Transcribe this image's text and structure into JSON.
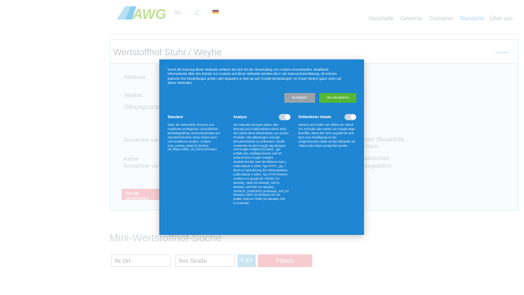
{
  "header": {
    "logo_text": "AWG",
    "icons": [
      "mail-icon",
      "phone-icon",
      "german-flag-icon"
    ],
    "nav": [
      {
        "label": "Haushalte",
        "active": false
      },
      {
        "label": "Gewerbe",
        "active": false
      },
      {
        "label": "Container",
        "active": false
      },
      {
        "label": "Standorte",
        "active": true
      },
      {
        "label": "Über uns",
        "active": false
      }
    ]
  },
  "card": {
    "title": "Wertstoffhof Stuhr / Weyhe",
    "labels": {
      "address": "Adresse",
      "phone": "Telefon",
      "hours": "Öffnungszeiten",
      "accepted_from": "Annahme von",
      "no": "Keine",
      "accepted_from2": "Annahme von"
    },
    "right_snippets": {
      "a": "eter (Bauabfälle,",
      "b": "chten",
      "c": "ahrischen",
      "d": "angeliefert."
    },
    "route_button": "Route berechnen"
  },
  "search": {
    "title": "Mini-Wertstoffhof-Suche",
    "place_placeholder": "Ihr Ort",
    "street_placeholder": "Ihre Straße",
    "radius": "5 km",
    "filter_label": "Filtern"
  },
  "cookie": {
    "intro": "Durch die Nutzung dieser Webseite erklären Sie sich mit der Verwendung von Cookies einverstanden. Detaillierte Informationen über den Einsatz von Cookies auf dieser Webseite erhalten Sie in der Datenschutzerklärung. Sie können jederzeit Ihre Einstellungen prüfen oder anpassen in dem sie auf \"Cookie-Einstellungen\" im Footer klicken (ganz unten auf dieser Webseite).",
    "settings_button": "Bestätigen",
    "accept_button": "Alle akzeptieren",
    "categories": [
      {
        "title": "Standard",
        "has_toggle": false,
        "description": "Stats, die wesentliche Services und Funktionen ermöglichen, einschließlich Identitätsprüfung, Servicekontinuität und Standortsicherheit. Diese Option kann nicht deaktiviert werden. Cookies: cms_cookies_saved (1 Woche), cnf_https-cookie_cnf_token (Session)"
      },
      {
        "title": "Analyse",
        "has_toggle": true,
        "description": "Wir sammeln anonyme Daten über Nutzung und Funktionalität unserer Seite. Wir nutzen diese Erkenntnisse, um unsere Produkte, Dienstleistungen und das Benutzererlebnis zu verbessern. Hierfür verwenden wir den Google Tag Manager und Google Analytics (Cookies: _ga: enthält eine zufallsgenerierte User-ID anhand derer Google Analytics wiederkehrende User identifizieren kann, Lebensdauer 2 Jahre, Typ HTTP; _ga_*: dient zur Speicherung des Sitzungsstatus, Lebensdauer 2 Jahre, Typ HTTP) Weitere Cookies von google.de: APISID (13 Monate), HSID (13 Monate), NID (6 Monate), SAPISID (13 Monate), SEARCH_SAMESITE (6 Monate), SID (13 Monate), SSID (13 Monate) und von double click.net: DSID (13 Monate), IDE (13 Monate)"
      },
      {
        "title": "Drittanbieter Inhalte",
        "has_toggle": true,
        "description": "Hinweis und Inhalte von Online wie Videos von YouTube oder Karten von Google Maps betreffen. Wenn hier nicht zugestimmt wird kann eine Einwilligung an der entsprechenden Stelle auf der Webseite mit Videos oder Maps nachgeholt werden."
      }
    ]
  },
  "colors": {
    "modal_bg": "#1e86d3",
    "accept": "#55b634",
    "settings": "#9aa3aa",
    "filter": "#eea2ab",
    "km": "#9fcfe8"
  }
}
